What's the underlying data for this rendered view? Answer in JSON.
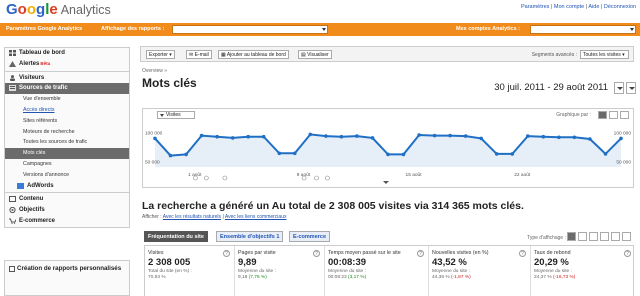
{
  "header": {
    "logo_google": "Google",
    "logo_analytics": "Analytics",
    "links": [
      "Paramètres",
      "Mon compte",
      "Aide",
      "Déconnexion"
    ]
  },
  "orange_bar": {
    "settings": "Paramètres Google Analytics",
    "report_view_label": "Affichage des rapports :",
    "accounts_label": "Mes comptes Analytics :"
  },
  "sidebar": {
    "items": [
      {
        "label": "Tableau de bord",
        "icon": "dashboard-icon"
      },
      {
        "label": "Alertes",
        "badge": "Bêta",
        "icon": "alert-icon"
      },
      {
        "label": "Visiteurs",
        "icon": "visitors-icon"
      },
      {
        "label": "Sources de trafic",
        "icon": "traffic-sources-icon"
      }
    ],
    "subitems": [
      "Vue d'ensemble",
      "Accès directs",
      "Sites référents",
      "Moteurs de recherche",
      "Toutes les sources de trafic",
      "Mots clés",
      "Campagnes",
      "Versions d'annonce"
    ],
    "adwords": "AdWords",
    "sections": [
      "Contenu",
      "Objectifs",
      "E-commerce"
    ],
    "create_reports": "Création de rapports personnalisés"
  },
  "toolbar": {
    "export": "Exporter",
    "email": "E-mail",
    "add_dashboard": "Ajouter au tableau de bord",
    "visualize": "Visualiser",
    "segments_label": "Segments avancés :",
    "segments_value": "Toutes les visites"
  },
  "page": {
    "breadcrumb": "Overview »",
    "title": "Mots clés",
    "date_range": "30 juil. 2011 - 29 août 2011",
    "headline": "La recherche a généré un Au total de 2 308 005 visites via 314 365 mots clés.",
    "show_prefix": "Afficher :",
    "show_paid_link": "Avec les résultats naturels",
    "show_sep": "|",
    "show_cost_link": "Avec les liens commerciaux"
  },
  "chart": {
    "metric_dropdown": "Visites",
    "graph_by_label": "Graphique par :"
  },
  "chart_data": {
    "type": "line",
    "series": [
      {
        "name": "Visites",
        "values": [
          90000,
          60000,
          62000,
          95000,
          93000,
          91000,
          93000,
          93000,
          64000,
          64000,
          97000,
          94000,
          93000,
          94000,
          91000,
          62000,
          62000,
          96000,
          95000,
          95000,
          94000,
          90000,
          63000,
          63000,
          94000,
          93000,
          92000,
          92000,
          89000,
          63000,
          90000
        ]
      }
    ],
    "y_ticks_left": [
      "100 000",
      "50 000"
    ],
    "y_ticks_right": [
      "100 000",
      "50 000"
    ],
    "x_ticks": [
      "1 août",
      "8 août",
      "15 août",
      "22 août"
    ],
    "ylim": [
      40000,
      110000
    ],
    "grid": false
  },
  "tabs": [
    "Fréquentation du site",
    "Ensemble d'objectifs 1",
    "E-commerce"
  ],
  "display_type_label": "Type d'affichage :",
  "metrics": [
    {
      "title": "Visites",
      "value": "2 308 005",
      "sub": "Total du site (en %) :",
      "sub2": "70,93 %",
      "change": ""
    },
    {
      "title": "Pages par visite",
      "value": "9,89",
      "sub": "Moyenne du site :",
      "sub2": "9,18",
      "change": "(7,76 %)"
    },
    {
      "title": "Temps moyen passé sur le site",
      "value": "00:08:39",
      "sub": "Moyenne du site :",
      "sub2": "00:08:23",
      "change": "(3,17 %)"
    },
    {
      "title": "Nouvelles visites (en %)",
      "value": "43,52 %",
      "sub": "Moyenne du site :",
      "sub2": "44,36 %",
      "change": "(-1,87 %)"
    },
    {
      "title": "Taux de rebond",
      "value": "20,29 %",
      "sub": "Moyenne du site :",
      "sub2": "24,37 %",
      "change": "(-16,73 %)"
    }
  ]
}
